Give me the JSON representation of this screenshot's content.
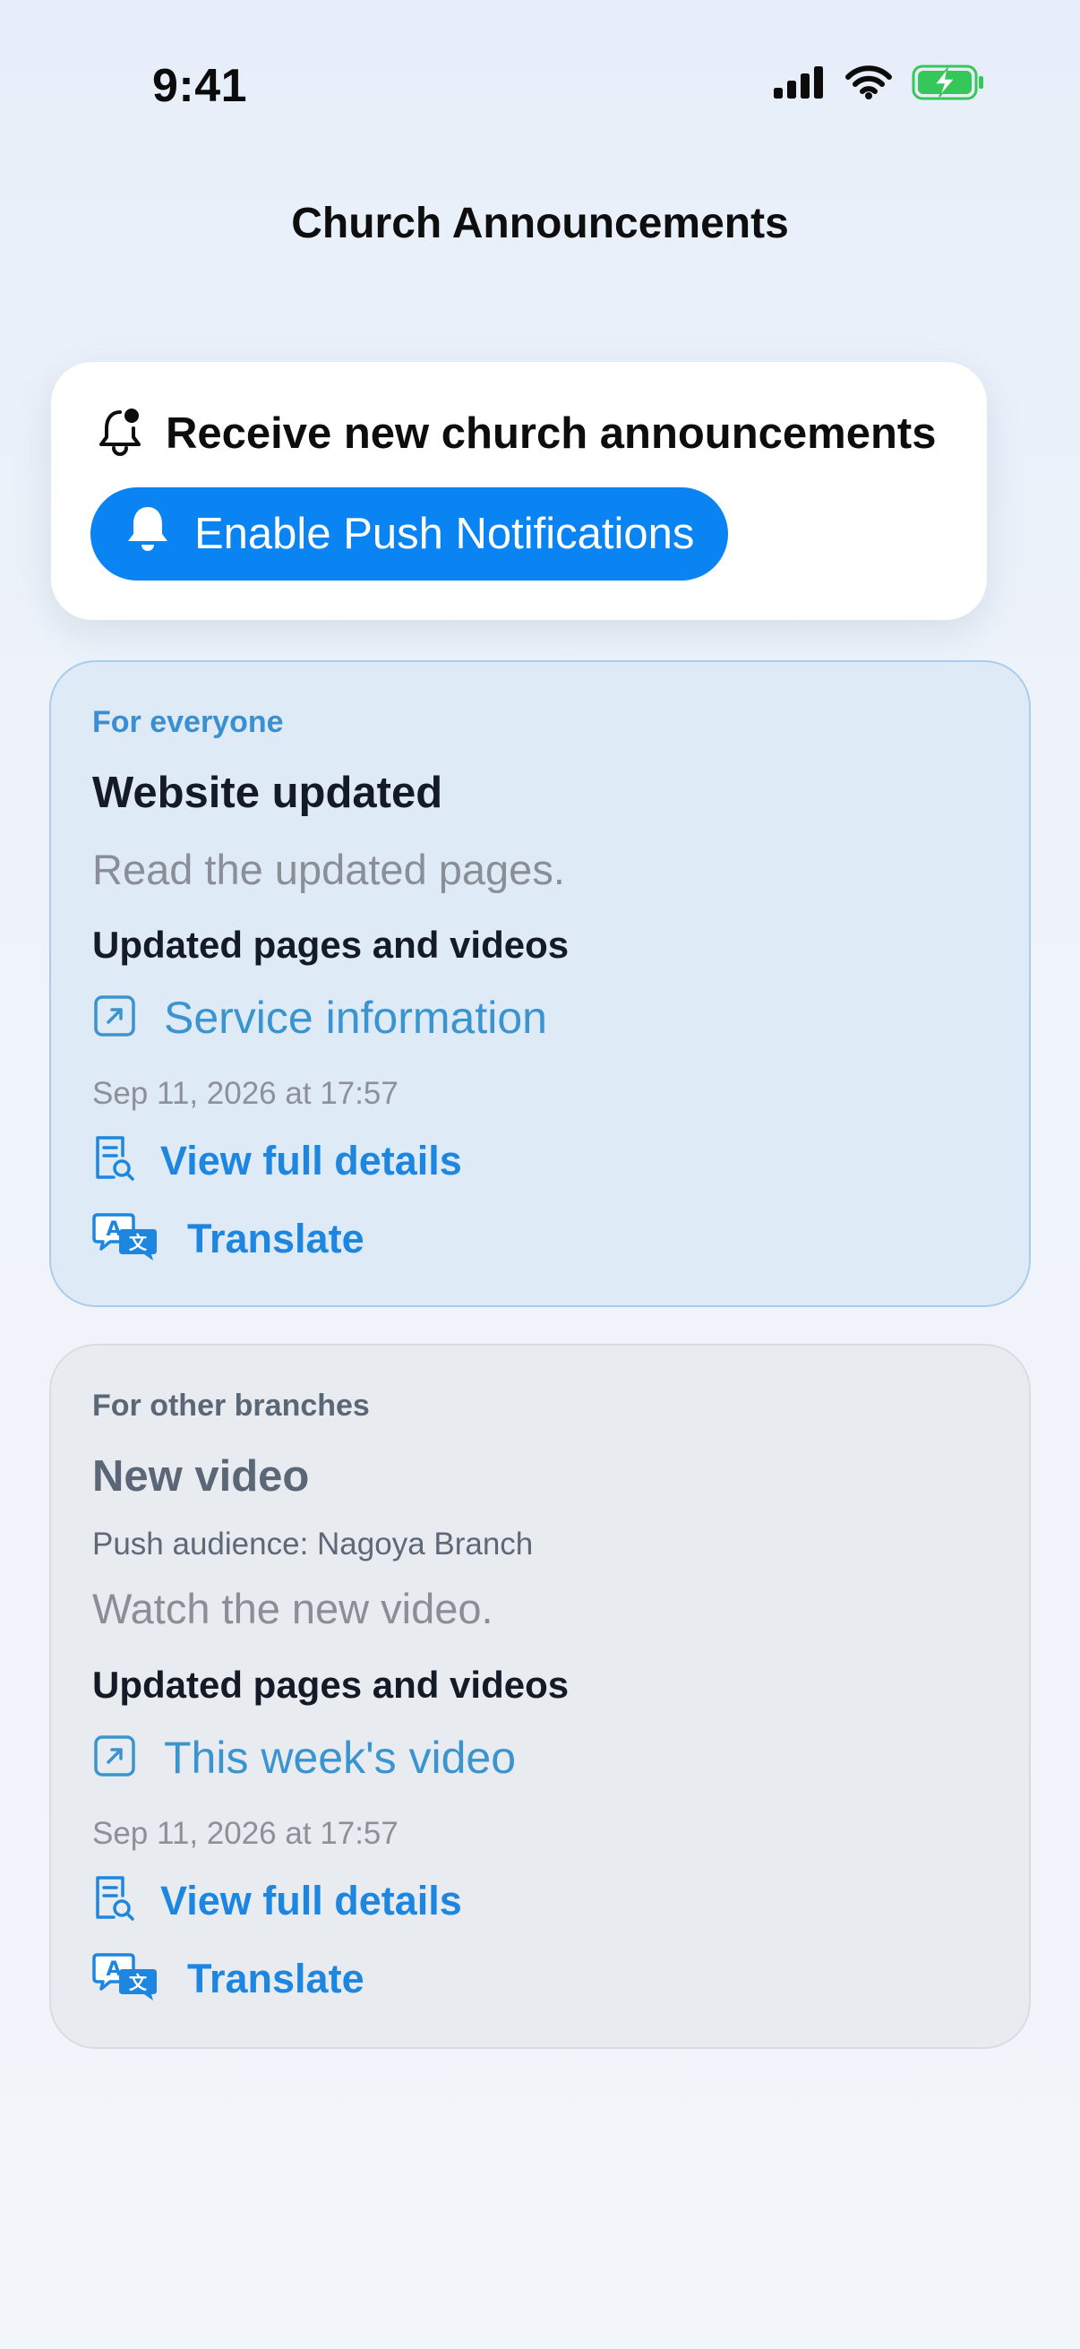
{
  "status_bar": {
    "time": "9:41"
  },
  "header": {
    "title": "Church Announcements"
  },
  "push_card": {
    "label": "Receive new church announcements",
    "button_label": "Enable Push Notifications"
  },
  "announcements": [
    {
      "tag": "For everyone",
      "title": "Website updated",
      "description": "Read the updated pages.",
      "section_title": "Updated pages and videos",
      "link_label": "Service information",
      "date": "Sep 11, 2026 at 17:57",
      "details_label": "View full details",
      "translate_label": "Translate"
    },
    {
      "tag": "For other branches",
      "title": "New video",
      "audience": "Push audience: Nagoya Branch",
      "description": "Watch the new video.",
      "section_title": "Updated pages and videos",
      "link_label": "This week's video",
      "date": "Sep 11, 2026 at 17:57",
      "details_label": "View full details",
      "translate_label": "Translate"
    }
  ],
  "colors": {
    "accent": "#0a84f2",
    "link": "#3a94cf",
    "card_highlight_bg": "#dfeaf7",
    "card_muted_bg": "#e8ebf0",
    "battery_green": "#34c759"
  },
  "icons": [
    "cellular-signal-icon",
    "wifi-icon",
    "battery-charging-icon",
    "bell-badge-icon",
    "bell-icon",
    "external-link-icon",
    "document-search-icon",
    "translate-icon"
  ]
}
